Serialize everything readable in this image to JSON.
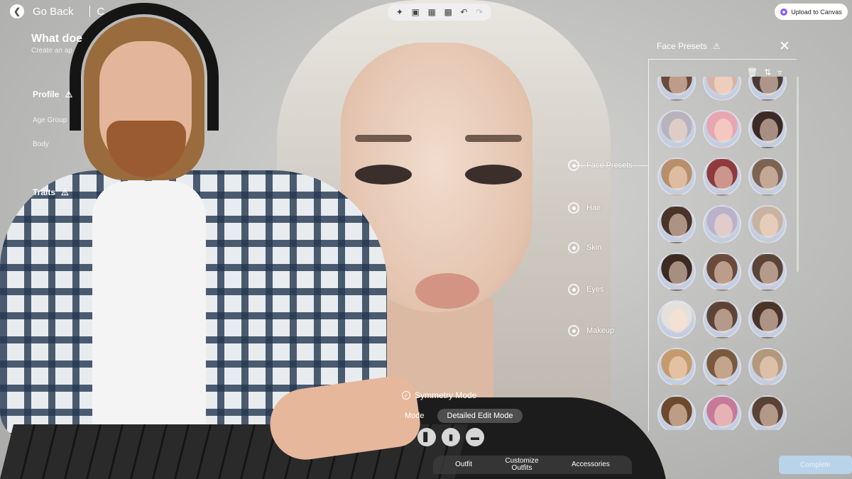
{
  "header": {
    "back_label": "Go Back",
    "crumb": "C",
    "title": "What doe",
    "subtitle": "Create an ap"
  },
  "left_panel": {
    "profile_label": "Profile",
    "age_group_label": "Age Group",
    "body_label": "Body",
    "traits_label": "Traits"
  },
  "toolbar": {
    "icons": [
      "sparkle-icon",
      "camera-icon",
      "capture-icon",
      "scan-icon",
      "undo-icon",
      "redo-icon"
    ]
  },
  "upload": {
    "label": "Upload to Canvas",
    "accent": "#8a5cf6"
  },
  "presets": {
    "title": "Face Presets",
    "thumb_colors": [
      [
        "#6b4a3a",
        "#d9b4a6",
        "#4a3a36"
      ],
      [
        "#b7b3bc",
        "#e6a6b2",
        "#3b2a26"
      ],
      [
        "#b88f6a",
        "#8f3a3f",
        "#7d6352"
      ],
      [
        "#4a3428",
        "#b9b2c8",
        "#c8b3a2"
      ],
      [
        "#3d2b22",
        "#6a4a3a",
        "#5a4438"
      ],
      [
        "#e4e0dc",
        "#5e4436",
        "#4a3428"
      ],
      [
        "#c49a6e",
        "#7a5a3e",
        "#b3987e"
      ],
      [
        "#6d4a2e",
        "#c77a98",
        "#5a4236"
      ]
    ]
  },
  "categories": [
    {
      "label": "Face Presets"
    },
    {
      "label": "Hair"
    },
    {
      "label": "Skin"
    },
    {
      "label": "Eyes"
    },
    {
      "label": "Makeup"
    }
  ],
  "edit": {
    "symmetry_label": "Symmetry Mode",
    "mode_label": "Mode",
    "detailed_mode_label": "Detailed Edit Mode"
  },
  "outfit_icons": [
    "pants-icon",
    "boots-icon",
    "sneakers-icon"
  ],
  "tabs": {
    "outfit": "Outfit",
    "customize_1": "Customize",
    "customize_2": "Outfits",
    "accessories": "Accessories"
  },
  "complete_label": "Complete"
}
